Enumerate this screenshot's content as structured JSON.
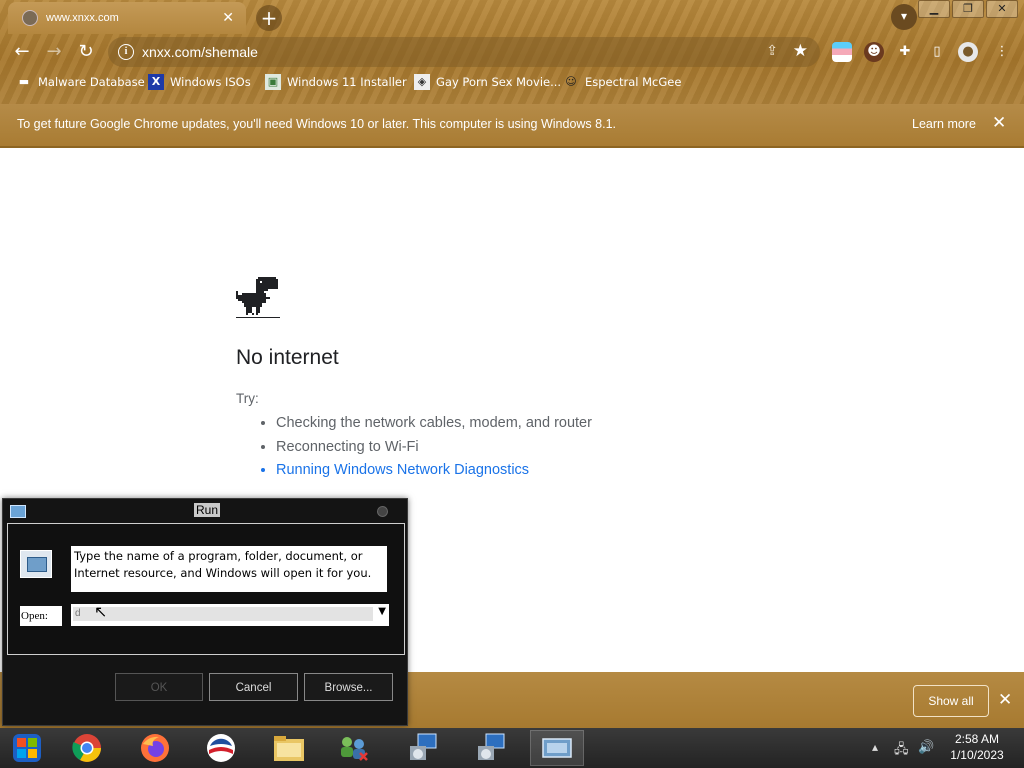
{
  "browser": {
    "tab": {
      "title": "www.xnxx.com",
      "close_glyph": "✕"
    },
    "new_tab_glyph": "+",
    "omnibox": {
      "url": "xnxx.com/shemale"
    },
    "bookmarks": [
      {
        "label": "Malware Database",
        "icon": "folder-icon"
      },
      {
        "label": "Windows ISOs",
        "icon": "x-logo-icon"
      },
      {
        "label": "Windows 11 Installer",
        "icon": "image-icon"
      },
      {
        "label": "Gay Porn Sex Movie...",
        "icon": "site-icon"
      },
      {
        "label": "Espectral McGee",
        "icon": "avatar-icon"
      }
    ],
    "infobar": {
      "message": "To get future Google Chrome updates, you'll need Windows 10 or later. This computer is using Windows 8.1.",
      "learn_more": "Learn more"
    }
  },
  "page": {
    "headline": "No internet",
    "try_label": "Try:",
    "suggestions": [
      "Checking the network cables, modem, and router",
      "Reconnecting to Wi-Fi",
      "Running Windows Network Diagnostics"
    ]
  },
  "download_shelf": {
    "show_all": "Show all"
  },
  "run_dialog": {
    "title": "Run",
    "description": "Type the name of a program, folder, document, or Internet resource, and Windows will open it for you.",
    "open_label": "Open:",
    "open_value": "d",
    "ok": "OK",
    "cancel": "Cancel",
    "browse": "Browse..."
  },
  "taskbar": {
    "time": "2:58 AM",
    "date": "1/10/2023"
  },
  "colors": {
    "theme_brown": "#a97c33",
    "link_blue": "#1a73e8"
  }
}
